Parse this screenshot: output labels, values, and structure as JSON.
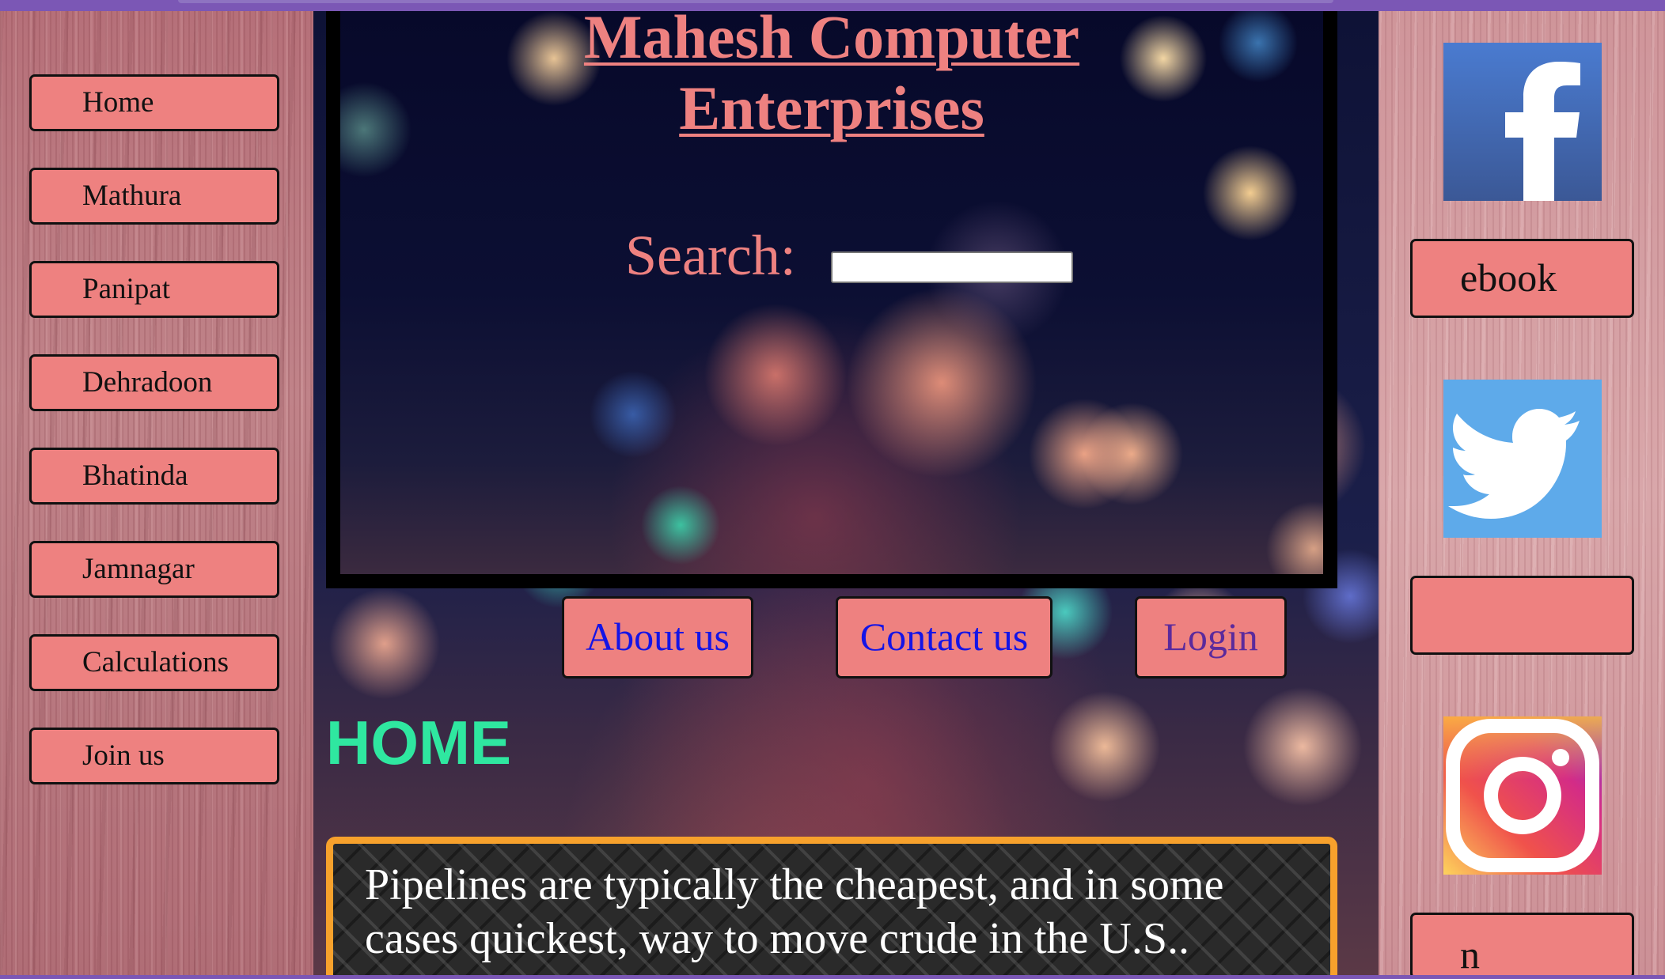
{
  "site": {
    "title": "Mahesh Computer Enterprises",
    "search_label": "Search:",
    "search_value": ""
  },
  "sidebar": {
    "items": [
      {
        "label": "Home"
      },
      {
        "label": "Mathura"
      },
      {
        "label": "Panipat"
      },
      {
        "label": "Dehradoon"
      },
      {
        "label": "Bhatinda"
      },
      {
        "label": "Jamnagar"
      },
      {
        "label": "Calculations"
      },
      {
        "label": "Join us"
      }
    ]
  },
  "top_links": {
    "about": "About us",
    "contact": "Contact us",
    "login": "Login"
  },
  "main": {
    "heading": "HOME",
    "article": "Pipelines are typically the cheapest, and in some cases quickest, way to move crude in the U.S.."
  },
  "social": {
    "facebook_label": "ebook",
    "twitter_label": "",
    "instagram_label": "n"
  },
  "colors": {
    "button_bg": "#ee8180",
    "heading": "#2fe7a0",
    "link_blue": "#1414e6",
    "link_visited": "#5b2a9c",
    "article_border": "#f7a12c"
  }
}
